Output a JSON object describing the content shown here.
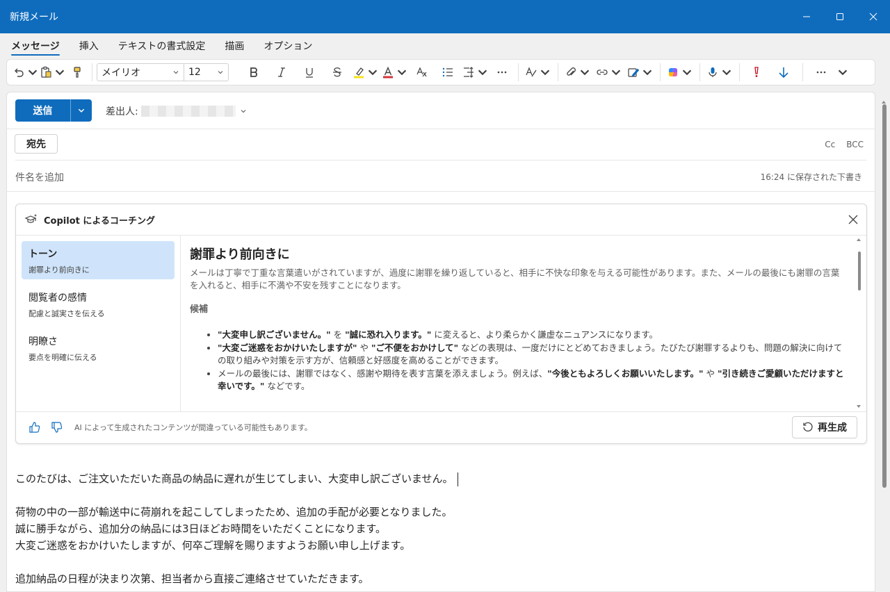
{
  "window": {
    "title": "新規メール"
  },
  "tabs": [
    "メッセージ",
    "挿入",
    "テキストの書式設定",
    "描画",
    "オプション"
  ],
  "toolbar": {
    "font_name": "メイリオ",
    "font_size": "12"
  },
  "compose": {
    "send_label": "送信",
    "from_label": "差出人:",
    "to_label": "宛先",
    "cc_label": "Cc",
    "bcc_label": "BCC",
    "subject_placeholder": "件名を追加",
    "saved_status": "16:24 に保存された下書き"
  },
  "copilot": {
    "header": "Copilot によるコーチング",
    "sidebar": [
      {
        "title": "トーン",
        "subtitle": "謝罪より前向きに"
      },
      {
        "title": "閲覧者の感情",
        "subtitle": "配慮と誠実さを伝える"
      },
      {
        "title": "明瞭さ",
        "subtitle": "要点を明確に伝える"
      }
    ],
    "content": {
      "heading": "謝罪より前向きに",
      "description": "メールは丁寧で丁重な言葉遣いがされていますが、過度に謝罪を繰り返していると、相手に不快な印象を与える可能性があります。また、メールの最後にも謝罪の言葉を入れると、相手に不満や不安を残すことになります。",
      "candidates_label": "候補",
      "b1_q1": "\"大変申し訳ございません。\"",
      "b1_mid": " を ",
      "b1_q2": "\"誠に恐れ入ります。\"",
      "b1_end": " に変えると、より柔らかく謙虚なニュアンスになります。",
      "b2_q1": "\"大変ご迷惑をおかけいたしますが\"",
      "b2_mid": " や ",
      "b2_q2": "\"ご不便をおかけして\"",
      "b2_end": " などの表現は、一度だけにとどめておきましょう。たびたび謝罪するよりも、問題の解決に向けての取り組みや対策を示す方が、信頼感と好感度を高めることができます。",
      "b3_start": "メールの最後には、謝罪ではなく、感謝や期待を表す言葉を添えましょう。例えば、",
      "b3_q1": "\"今後ともよろしくお願いいたします。\"",
      "b3_mid": " や ",
      "b3_q2": "\"引き続きご愛顧いただけますと幸いです。\"",
      "b3_end": " などです。"
    },
    "disclaimer": "AI によって生成されたコンテンツが間違っている可能性もあります。",
    "regenerate_label": "再生成"
  },
  "body": {
    "line1": "このたびは、ご注文いただいた商品の納品に遅れが生じてしまい、大変申し訳ございません。",
    "line2": "荷物の中の一部が輸送中に荷崩れを起こしてしまったため、追加の手配が必要となりました。",
    "line3": "誠に勝手ながら、追加分の納品には3日ほどお時間をいただくことになります。",
    "line4": "大変ご迷惑をおかけいたしますが、何卒ご理解を賜りますようお願い申し上げます。",
    "line5": "追加納品の日程が決まり次第、担当者から直接ご連絡させていただきます。"
  }
}
